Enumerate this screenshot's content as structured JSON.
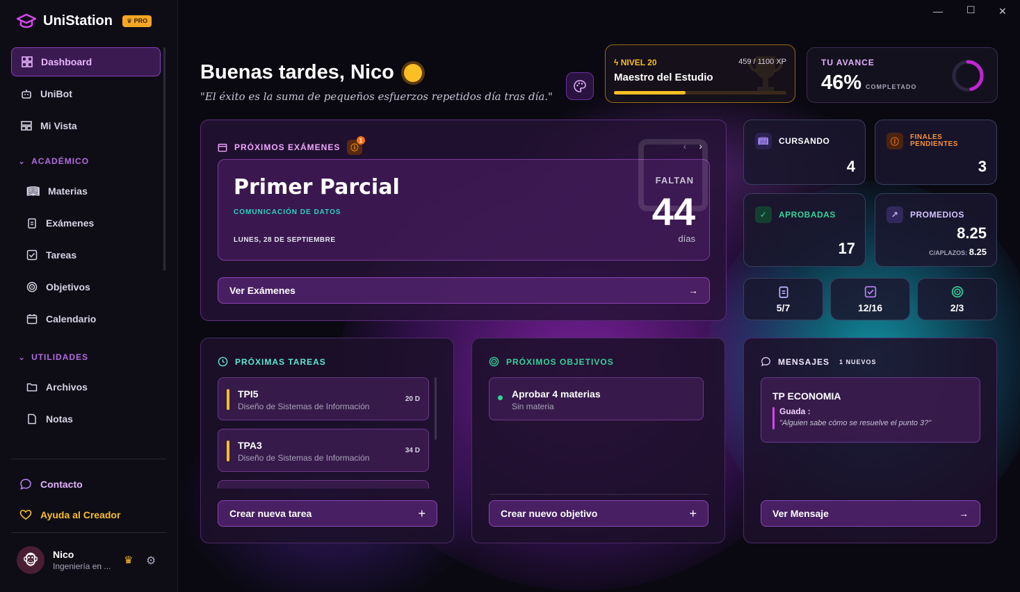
{
  "brand": {
    "name": "UniStation",
    "badge": "PRO"
  },
  "nav": {
    "dashboard": "Dashboard",
    "unibot": "UniBot",
    "mi_vista": "Mi Vista"
  },
  "sections": {
    "academico": "ACADÉMICO",
    "utilidades": "UTILIDADES"
  },
  "academico": {
    "materias": "Materias",
    "examenes": "Exámenes",
    "tareas": "Tareas",
    "objetivos": "Objetivos",
    "calendario": "Calendario"
  },
  "utilidades": {
    "archivos": "Archivos",
    "notas": "Notas"
  },
  "footer": {
    "contacto": "Contacto",
    "ayuda": "Ayuda al Creador"
  },
  "profile": {
    "name": "Nico",
    "career": "Ingeniería en ..."
  },
  "header": {
    "greeting": "Buenas tardes, Nico",
    "quote": "\"El éxito es la suma de pequeños esfuerzos repetidos día tras día.\""
  },
  "level": {
    "tag": "NIVEL 20",
    "xp": "459 / 1100 XP",
    "title": "Maestro del Estudio",
    "progress": 0.417
  },
  "avance": {
    "tag": "TU AVANCE",
    "pct": "46%",
    "label": "COMPLETADO",
    "value": 0.46
  },
  "exam": {
    "header": "PRÓXIMOS EXÁMENES",
    "badge": "1",
    "title": "Primer Parcial",
    "subject": "COMUNICACIÓN DE DATOS",
    "date": "LUNES, 28 DE SEPTIEMBRE",
    "faltan": "FALTAN",
    "days": "44",
    "days_label": "días",
    "button": "Ver Exámenes"
  },
  "stats": {
    "cursando": {
      "label": "CURSANDO",
      "value": "4"
    },
    "finales": {
      "label1": "FINALES",
      "label2": "PENDIENTES",
      "value": "3"
    },
    "aprobadas": {
      "label": "APROBADAS",
      "value": "17"
    },
    "promedios": {
      "label": "PROMEDIOS",
      "value": "8.25",
      "aplazos_label": "C/APLAZOS:",
      "aplazos_value": "8.25"
    }
  },
  "mini": {
    "examenes": "5/7",
    "tareas": "12/16",
    "objetivos": "2/3"
  },
  "tareas": {
    "header": "PRÓXIMAS TAREAS",
    "items": [
      {
        "title": "TPI5",
        "subject": "Diseño de Sistemas de Información",
        "due": "20 D"
      },
      {
        "title": "TPA3",
        "subject": "Diseño de Sistemas de Información",
        "due": "34 D"
      }
    ],
    "button": "Crear nueva tarea"
  },
  "objetivos": {
    "header": "PRÓXIMOS OBJETIVOS",
    "items": [
      {
        "title": "Aprobar 4 materias",
        "subject": "Sin materia"
      }
    ],
    "button": "Crear nuevo objetivo"
  },
  "mensajes": {
    "header": "MENSAJES",
    "count": "1 NUEVOS",
    "title": "TP ECONOMIA",
    "author": "Guada :",
    "text": "\"Alguien sabe cómo se resuelve el punto 3?\"",
    "button": "Ver Mensaje"
  },
  "colors": {
    "accent": "#b46be0",
    "gold": "#fbbf24",
    "teal": "#2dd4bf"
  }
}
